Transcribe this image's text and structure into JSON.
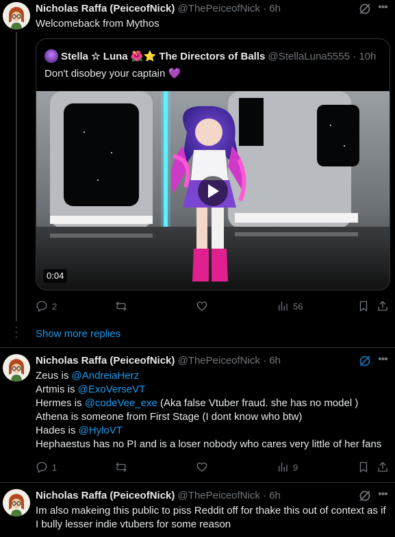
{
  "colors": {
    "background": "#000000",
    "text": "#e7e9ea",
    "secondary": "#71767b",
    "accent": "#1d9bf0",
    "border": "#2f3336"
  },
  "tweet1": {
    "name": "Nicholas Raffa (PeiceofNick)",
    "handle": "@ThePeiceofNick",
    "sep": "·",
    "time": "6h",
    "text": "Welcomeback from Mythos",
    "quote": {
      "name": "Stella ☆ Luna 🌺⭐ The Directors of Balls",
      "handle": "@StellaLuna5555",
      "sep": "·",
      "time": "10h",
      "text": "Don't disobey your captain 💜",
      "video_duration": "0:04"
    },
    "actions": {
      "replies": "2",
      "reposts": "",
      "likes": "",
      "views": "56"
    }
  },
  "show_more": "Show more replies",
  "tweet2": {
    "name": "Nicholas Raffa (PeiceofNick)",
    "handle": "@ThePeiceofNick",
    "sep": "·",
    "time": "6h",
    "lines": [
      {
        "prefix": "Zeus is ",
        "mention": "@AndreiaHerz",
        "suffix": ""
      },
      {
        "prefix": "Artmis is ",
        "mention": "@ExoVerseVT",
        "suffix": ""
      },
      {
        "prefix": "Hermes is ",
        "mention": "@codeVee_exe",
        "suffix": " (Aka false Vtuber fraud. she has no model )"
      },
      {
        "prefix": "Athena is someone from First Stage (I dont know  who btw)",
        "mention": "",
        "suffix": ""
      },
      {
        "prefix": "Hades is ",
        "mention": "@HyloVT",
        "suffix": ""
      },
      {
        "prefix": "Hephaestus has no PI and is a loser nobody who cares very little of her fans",
        "mention": "",
        "suffix": ""
      }
    ],
    "actions": {
      "replies": "1",
      "reposts": "",
      "likes": "",
      "views": "9"
    }
  },
  "tweet3": {
    "name": "Nicholas Raffa (PeiceofNick)",
    "handle": "@ThePeiceofNick",
    "sep": "·",
    "time": "6h",
    "lines": [
      "Im also makeing this public to piss Reddit off for thake this out of context as if",
      "I bully lesser indie vtubers for some reason"
    ]
  },
  "icons": [
    "avatar-icon",
    "grok-icon",
    "more-icon",
    "reply-icon",
    "repost-icon",
    "like-icon",
    "views-icon",
    "bookmark-icon",
    "share-icon",
    "play-icon"
  ]
}
